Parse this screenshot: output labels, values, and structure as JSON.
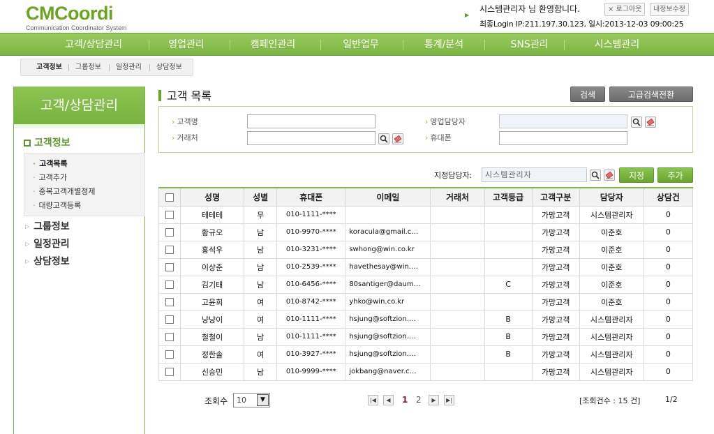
{
  "header": {
    "logo_main": "CMCoordi",
    "logo_sub": "Communication Coordinator System",
    "welcome": "시스템관리자 님 환영합니다.",
    "last_login": "최종Login IP:211.197.30.123, 일시:2013-12-03 09:00:25",
    "logout_label": "× 로그아웃",
    "myinfo_label": "내정보수정"
  },
  "nav": [
    "고객/상담관리",
    "영업관리",
    "캠페인관리",
    "일반업무",
    "통계/분석",
    "SNS관리",
    "시스템관리"
  ],
  "subtabs": [
    "고객정보",
    "그룹정보",
    "일정관리",
    "상담정보"
  ],
  "sidebar": {
    "title": "고객/상담관리",
    "main": "고객정보",
    "sub_items": [
      "고객목록",
      "고객추가",
      "중복고객개별정제",
      "대량고객등록"
    ],
    "groups": [
      "그룹정보",
      "일정관리",
      "상담정보"
    ]
  },
  "main": {
    "title": "고객 목록",
    "search_button": "검색",
    "advanced_button": "고급검색전환",
    "fields": {
      "customer_name": "고객명",
      "sales_manager": "영업담당자",
      "account": "거래처",
      "mobile": "휴대폰"
    },
    "assign_label": "지정담당자:",
    "assign_value": "시스템관리자",
    "assign_button": "지정",
    "add_button": "추가"
  },
  "table": {
    "headers": [
      "성명",
      "성별",
      "휴대폰",
      "이메일",
      "거래처",
      "고객등급",
      "고객구분",
      "담당자",
      "상담건"
    ],
    "rows": [
      [
        "테테테",
        "무",
        "010-1111-****",
        "",
        "",
        "",
        "가망고객",
        "시스템관리자",
        "0"
      ],
      [
        "황규오",
        "남",
        "010-9970-****",
        "koracula@gmail.c…",
        "",
        "",
        "가망고객",
        "이준호",
        "0"
      ],
      [
        "홍석우",
        "남",
        "010-3231-****",
        "swhong@win.co.kr",
        "",
        "",
        "가망고객",
        "이준호",
        "0"
      ],
      [
        "이상준",
        "남",
        "010-2539-****",
        "havethesay@win.…",
        "",
        "",
        "가망고객",
        "이준호",
        "0"
      ],
      [
        "김기태",
        "남",
        "010-6456-****",
        "80santiger@daum…",
        "",
        "C",
        "가망고객",
        "이준호",
        "0"
      ],
      [
        "고윤희",
        "여",
        "010-8742-****",
        "yhko@win.co.kr",
        "",
        "",
        "가망고객",
        "이준호",
        "0"
      ],
      [
        "냥냥이",
        "여",
        "010-1111-****",
        "hsjung@softzion.…",
        "",
        "B",
        "가망고객",
        "시스템관리자",
        "0"
      ],
      [
        "철철이",
        "남",
        "010-1111-****",
        "hsjung@softzion.…",
        "",
        "B",
        "가망고객",
        "시스템관리자",
        "0"
      ],
      [
        "정한솔",
        "여",
        "010-3927-****",
        "hsjung@softzion.…",
        "",
        "B",
        "가망고객",
        "시스템관리자",
        "0"
      ],
      [
        "신승민",
        "남",
        "010-9999-****",
        "jokbang@naver.c…",
        "",
        "",
        "가망고객",
        "시스템관리자",
        "0"
      ]
    ]
  },
  "pager": {
    "rows_label": "조회수",
    "rows_value": "10",
    "pages": [
      "1",
      "2"
    ],
    "current_page": "1",
    "count_text": "[조회건수 : 15 건]",
    "page_info": "1/2"
  },
  "colors": {
    "brand_green": "#6aa51e",
    "nav_green": "#7cb542",
    "accent_orange": "#e39a2e"
  }
}
